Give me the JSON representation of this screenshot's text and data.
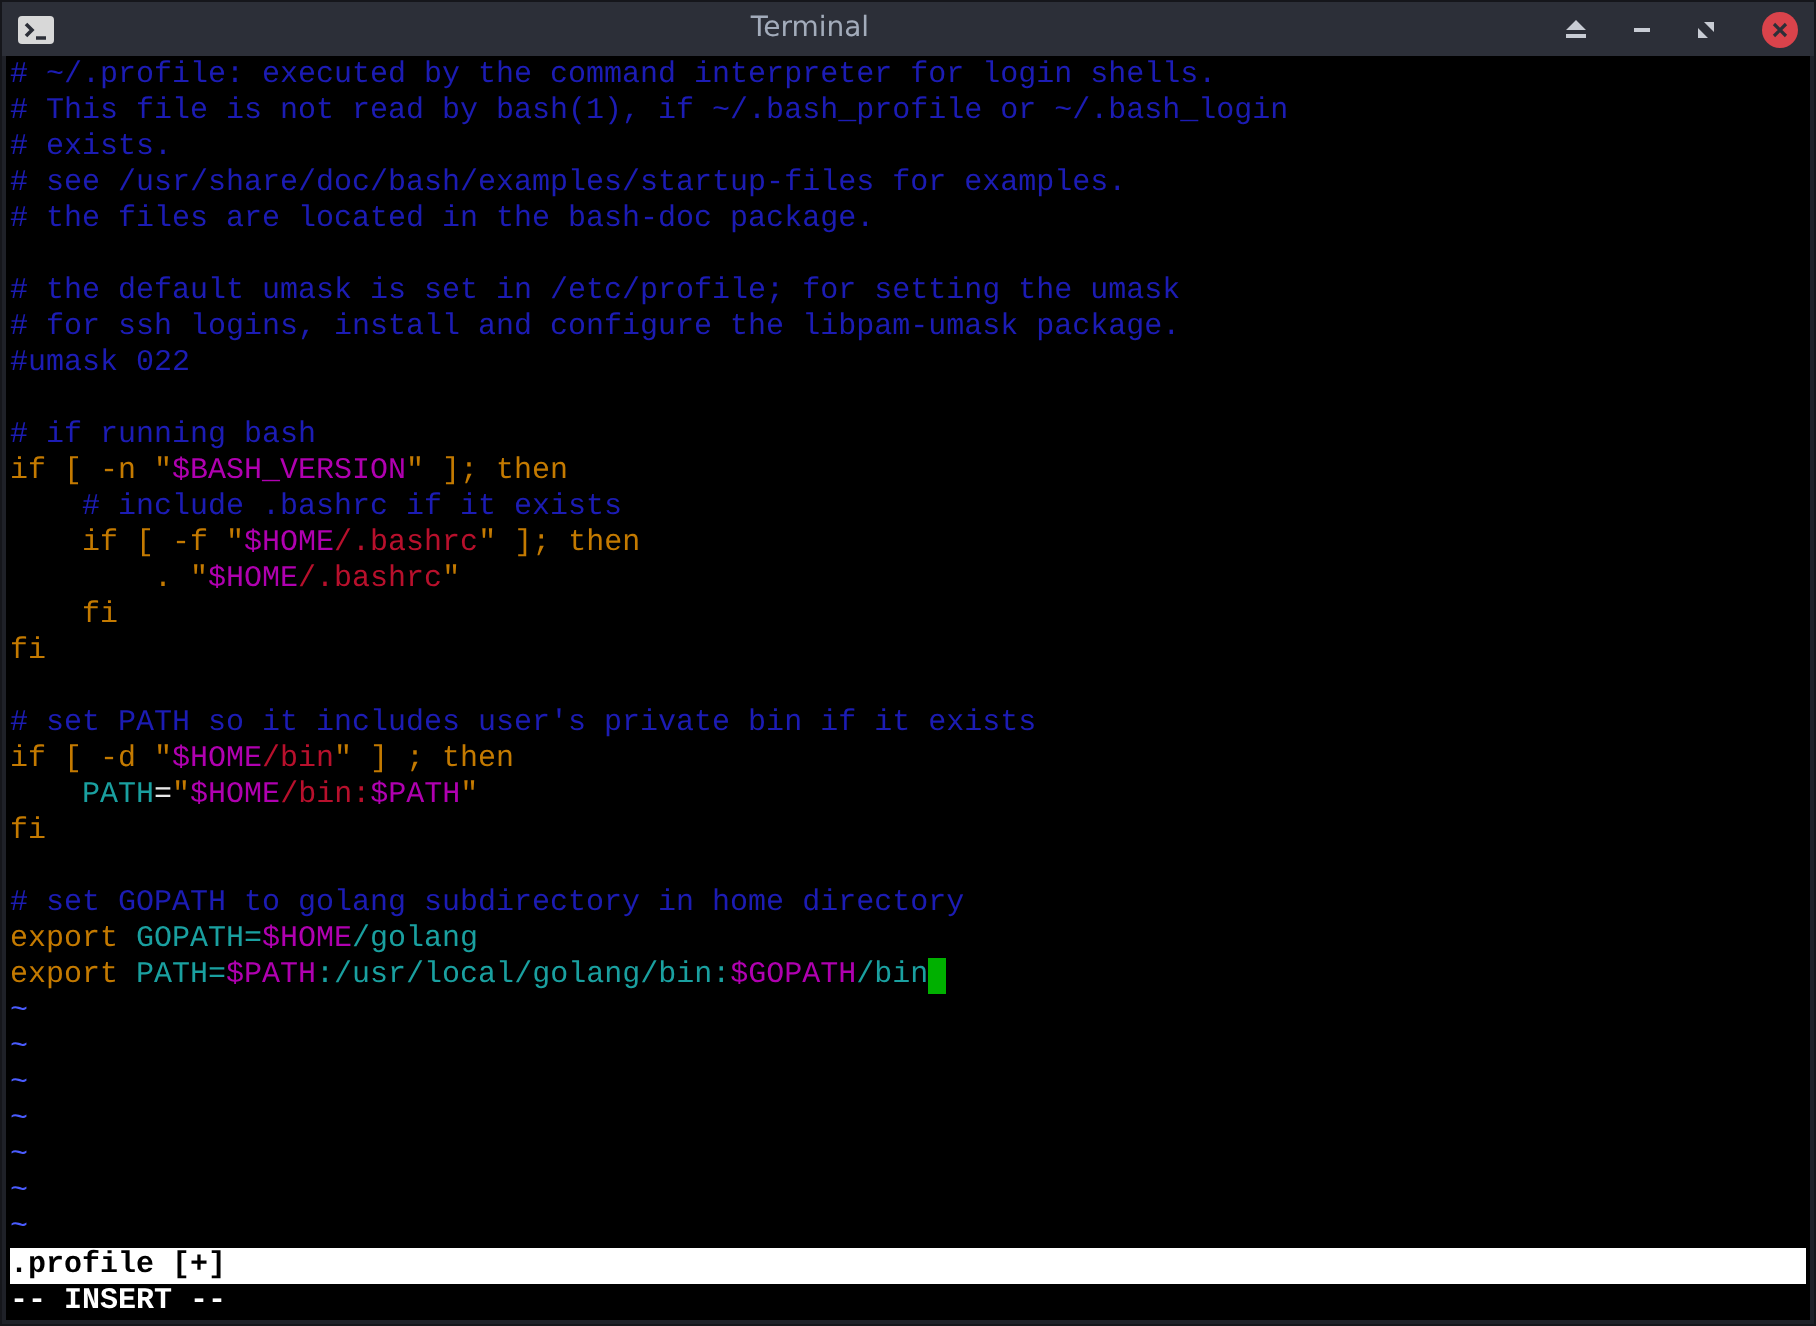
{
  "window": {
    "title": "Terminal"
  },
  "editor": {
    "lines": [
      {
        "kind": "code",
        "segments": [
          {
            "kind": "comment",
            "text": "# ~/.profile: executed by the command interpreter for login shells."
          }
        ]
      },
      {
        "kind": "code",
        "segments": [
          {
            "kind": "comment",
            "text": "# This file is not read by bash(1), if ~/.bash_profile or ~/.bash_login"
          }
        ]
      },
      {
        "kind": "code",
        "segments": [
          {
            "kind": "comment",
            "text": "# exists."
          }
        ]
      },
      {
        "kind": "code",
        "segments": [
          {
            "kind": "comment",
            "text": "# see /usr/share/doc/bash/examples/startup-files for examples."
          }
        ]
      },
      {
        "kind": "code",
        "segments": [
          {
            "kind": "comment",
            "text": "# the files are located in the bash-doc package."
          }
        ]
      },
      {
        "kind": "blank"
      },
      {
        "kind": "code",
        "segments": [
          {
            "kind": "comment",
            "text": "# the default umask is set in /etc/profile; for setting the umask"
          }
        ]
      },
      {
        "kind": "code",
        "segments": [
          {
            "kind": "comment",
            "text": "# for ssh logins, install and configure the libpam-umask package."
          }
        ]
      },
      {
        "kind": "code",
        "segments": [
          {
            "kind": "comment",
            "text": "#umask 022"
          }
        ]
      },
      {
        "kind": "blank"
      },
      {
        "kind": "code",
        "segments": [
          {
            "kind": "comment",
            "text": "# if running bash"
          }
        ]
      },
      {
        "kind": "code",
        "segments": [
          {
            "kind": "keyword",
            "text": "if [ -n \""
          },
          {
            "kind": "variable",
            "text": "$BASH_VERSION"
          },
          {
            "kind": "keyword",
            "text": "\" ]; then"
          }
        ]
      },
      {
        "kind": "code",
        "indented": true,
        "segments": [
          {
            "kind": "comment",
            "text": "# include .bashrc if it exists"
          }
        ]
      },
      {
        "kind": "code",
        "segments": [
          {
            "kind": "keyword",
            "text": "    if [ -f \""
          },
          {
            "kind": "variable",
            "text": "$HOME"
          },
          {
            "kind": "string",
            "text": "/.bashrc"
          },
          {
            "kind": "keyword",
            "text": "\" ]; then"
          }
        ]
      },
      {
        "kind": "code",
        "segments": [
          {
            "kind": "keyword",
            "text": "        . \""
          },
          {
            "kind": "variable",
            "text": "$HOME"
          },
          {
            "kind": "string",
            "text": "/.bashrc"
          },
          {
            "kind": "keyword",
            "text": "\""
          }
        ]
      },
      {
        "kind": "code",
        "segments": [
          {
            "kind": "keyword",
            "text": "    fi"
          }
        ]
      },
      {
        "kind": "code",
        "segments": [
          {
            "kind": "keyword",
            "text": "fi"
          }
        ]
      },
      {
        "kind": "blank"
      },
      {
        "kind": "code",
        "segments": [
          {
            "kind": "comment",
            "text": "# set PATH so it includes user's private bin if it exists"
          }
        ]
      },
      {
        "kind": "code",
        "segments": [
          {
            "kind": "keyword",
            "text": "if [ -d \""
          },
          {
            "kind": "variable",
            "text": "$HOME"
          },
          {
            "kind": "string",
            "text": "/bin"
          },
          {
            "kind": "keyword",
            "text": "\" ] ; then"
          }
        ]
      },
      {
        "kind": "code",
        "indented": true,
        "segments": [
          {
            "kind": "identifier",
            "text": "PATH"
          },
          {
            "kind": "plain",
            "text": "="
          },
          {
            "kind": "keyword",
            "text": "\""
          },
          {
            "kind": "variable",
            "text": "$HOME"
          },
          {
            "kind": "string",
            "text": "/bin:"
          },
          {
            "kind": "variable",
            "text": "$PATH"
          },
          {
            "kind": "keyword",
            "text": "\""
          }
        ]
      },
      {
        "kind": "code",
        "segments": [
          {
            "kind": "keyword",
            "text": "fi"
          }
        ]
      },
      {
        "kind": "blank"
      },
      {
        "kind": "code",
        "segments": [
          {
            "kind": "comment",
            "text": "# set GOPATH to golang subdirectory in home directory"
          }
        ]
      },
      {
        "kind": "code",
        "segments": [
          {
            "kind": "keyword",
            "text": "export "
          },
          {
            "kind": "identifier",
            "text": "GOPATH="
          },
          {
            "kind": "variable",
            "text": "$HOME"
          },
          {
            "kind": "identifier",
            "text": "/golang"
          }
        ]
      },
      {
        "kind": "code",
        "cursor": true,
        "segments": [
          {
            "kind": "keyword",
            "text": "export "
          },
          {
            "kind": "identifier",
            "text": "PATH="
          },
          {
            "kind": "variable",
            "text": "$PATH"
          },
          {
            "kind": "identifier",
            "text": ":/usr/local/golang/bin:"
          },
          {
            "kind": "variable",
            "text": "$GOPATH"
          },
          {
            "kind": "identifier",
            "text": "/bin"
          }
        ]
      },
      {
        "kind": "tilde",
        "text": "~"
      },
      {
        "kind": "tilde",
        "text": "~"
      },
      {
        "kind": "tilde",
        "text": "~"
      },
      {
        "kind": "tilde",
        "text": "~"
      },
      {
        "kind": "tilde",
        "text": "~"
      },
      {
        "kind": "tilde",
        "text": "~"
      },
      {
        "kind": "tilde",
        "text": "~"
      }
    ]
  },
  "status_line": ".profile [+]",
  "mode_line": "-- INSERT --"
}
